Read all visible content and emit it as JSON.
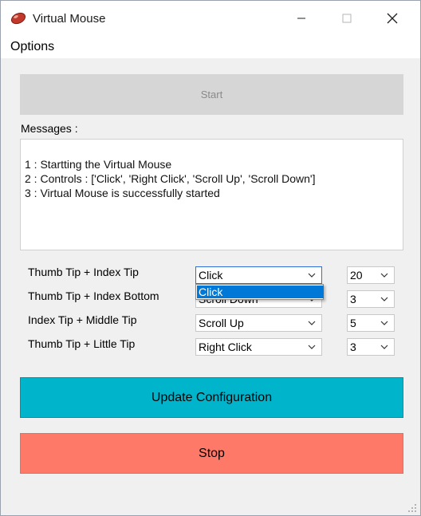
{
  "window": {
    "title": "Virtual Mouse",
    "app_icon": "mouse-icon"
  },
  "menu": {
    "options": "Options"
  },
  "start_label": "Start",
  "messages": {
    "label": "Messages :",
    "lines": [
      "1 : Startting the Virtual Mouse",
      "2 : Controls : ['Click', 'Right Click', 'Scroll Up', 'Scroll Down']",
      "3 : Virtual Mouse is successfully started"
    ]
  },
  "gestures": [
    {
      "label": "Thumb Tip + Index Tip",
      "action": "Click",
      "value": "20"
    },
    {
      "label": "Thumb Tip + Index Bottom",
      "action": "Scroll Down",
      "value": "3"
    },
    {
      "label": "Index Tip + Middle Tip",
      "action": "Scroll Up",
      "value": "5"
    },
    {
      "label": "Thumb Tip + Little Tip",
      "action": "Right Click",
      "value": "3"
    }
  ],
  "dropdown_open": {
    "highlighted": "Click"
  },
  "update_label": "Update Configuration",
  "stop_label": "Stop",
  "colors": {
    "update": "#00b4cc",
    "stop": "#ff7968",
    "start_disabled": "#d6d6d6",
    "highlight": "#0078d7"
  }
}
